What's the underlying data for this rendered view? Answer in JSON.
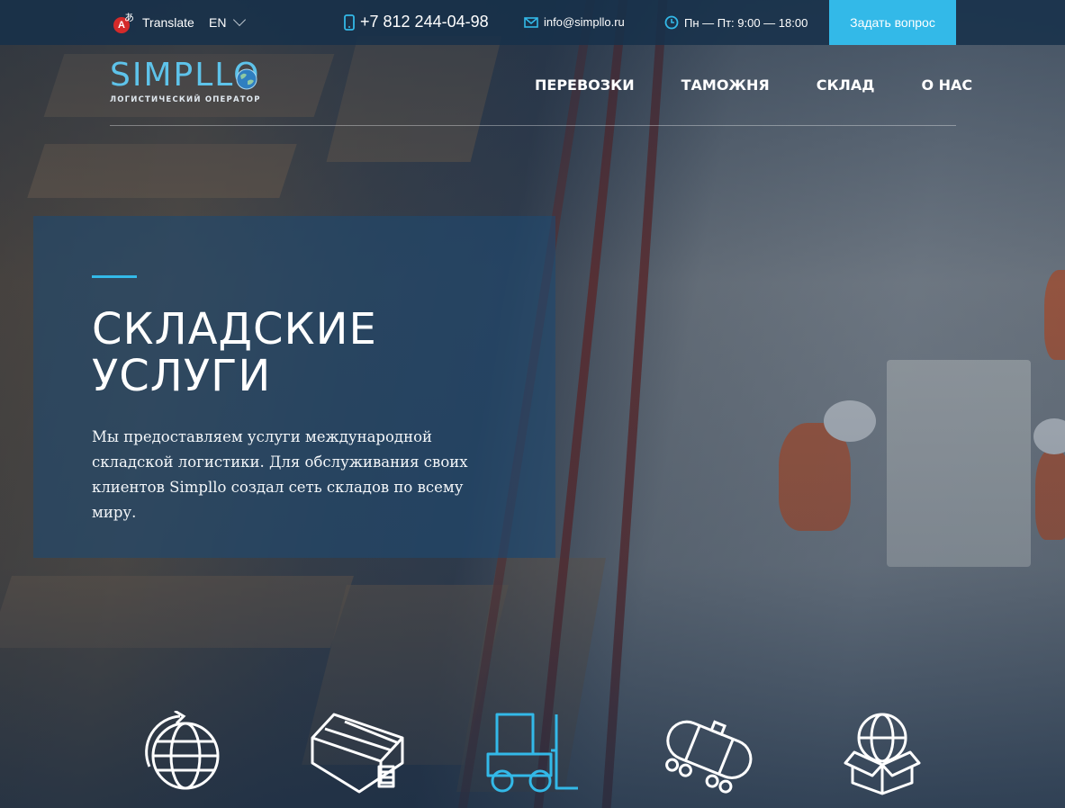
{
  "topbar": {
    "translate_label": "Translate",
    "translate_icon": "translate-icon",
    "translate_glyph_a": "A",
    "translate_glyph_b": "あ",
    "language": "EN",
    "phone": "+7 812 244-04-98",
    "phone_icon": "mobile-phone-icon",
    "email": "info@simpllo.ru",
    "email_icon": "envelope-icon",
    "hours": "Пн — Пт: 9:00 — 18:00",
    "hours_icon": "clock-icon",
    "ask_button": "Задать вопрос"
  },
  "header": {
    "logo_text": "SIMPLLO",
    "logo_subtitle": "ЛОГИСТИЧЕСКИЙ ОПЕРАТОР",
    "nav": [
      {
        "label": "ПЕРЕВОЗКИ"
      },
      {
        "label": "ТАМОЖНЯ"
      },
      {
        "label": "СКЛАД"
      },
      {
        "label": "О НАС"
      }
    ]
  },
  "hero": {
    "title": "СКЛАДСКИЕ УСЛУГИ",
    "text": "Мы предоставляем услуги международной складской логистики. Для обслуживания своих клиентов Simpllo создал сеть складов по всему миру."
  },
  "services": [
    {
      "icon": "globe-arrow-icon",
      "active": false
    },
    {
      "icon": "warehouse-icon",
      "active": false
    },
    {
      "icon": "forklift-icon",
      "active": true
    },
    {
      "icon": "tank-wagon-icon",
      "active": false
    },
    {
      "icon": "box-globe-icon",
      "active": false
    }
  ],
  "colors": {
    "accent": "#33b9e8",
    "topbar_bg": "#16304a",
    "hero_panel": "#1e4870"
  }
}
